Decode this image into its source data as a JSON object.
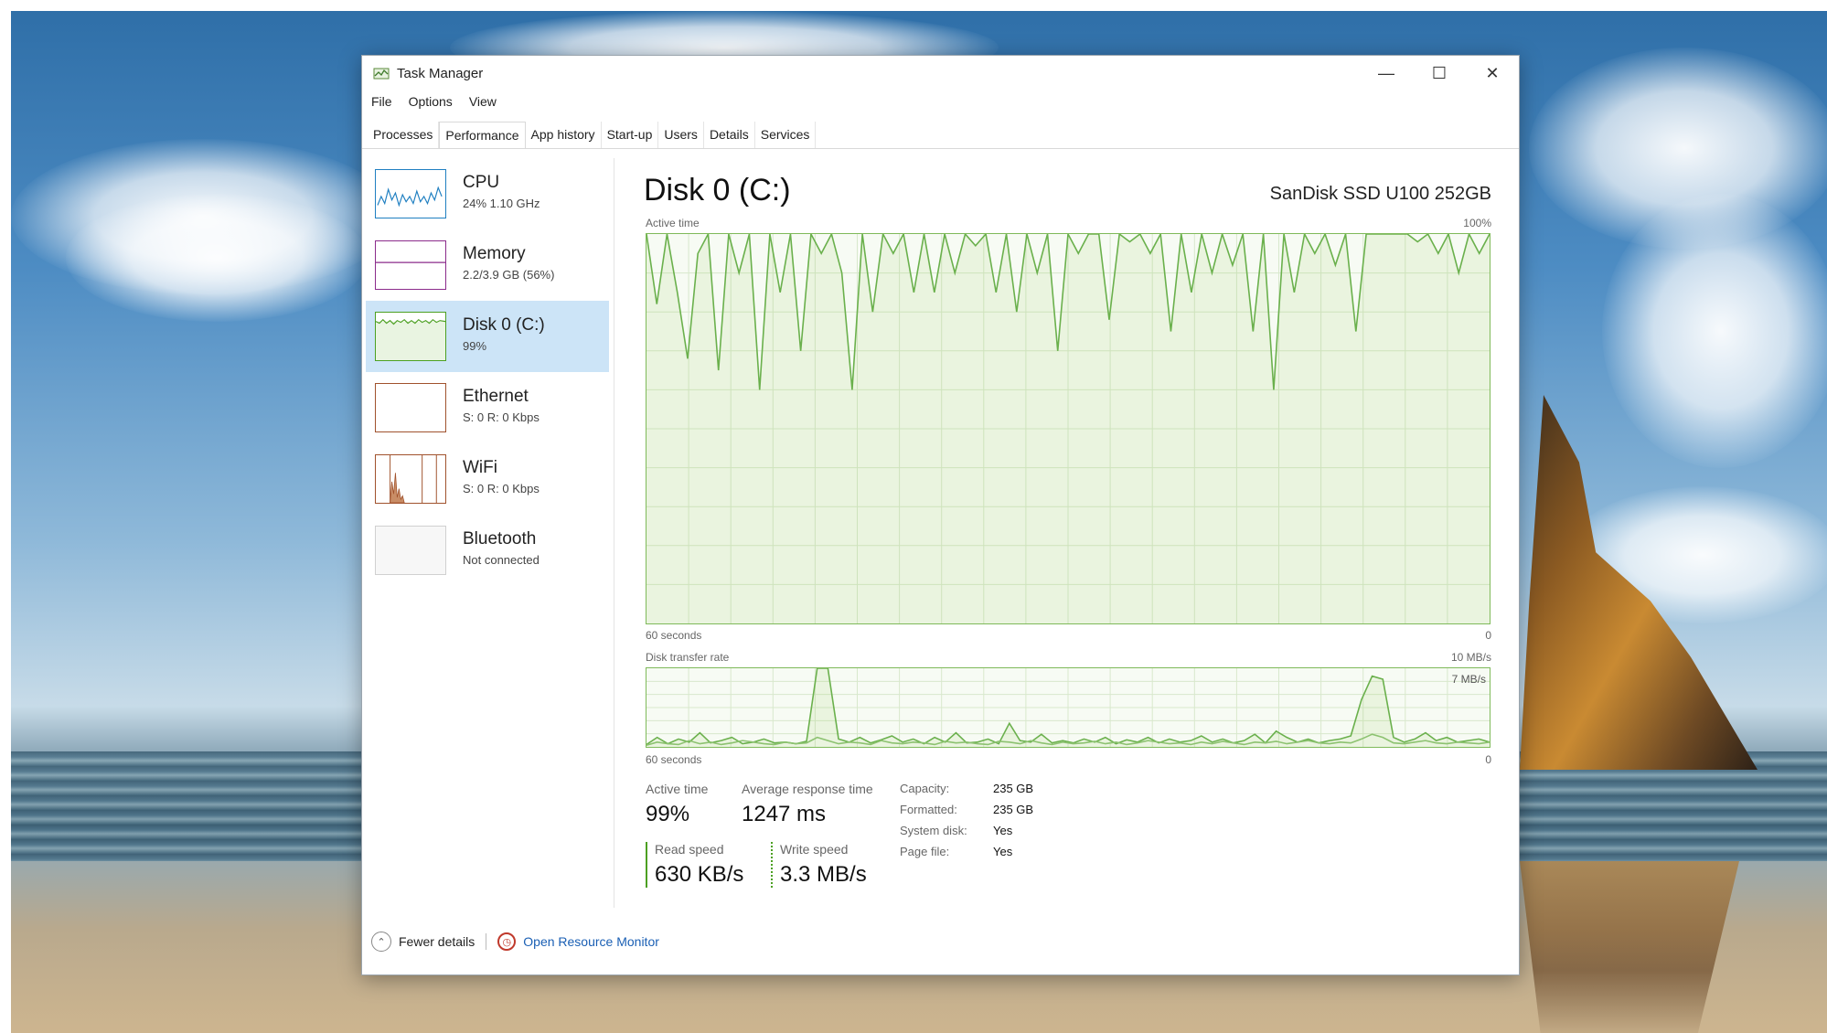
{
  "window": {
    "title": "Task Manager",
    "controls": {
      "minimize": "—",
      "maximize": "☐",
      "close": "✕"
    }
  },
  "menu": [
    "File",
    "Options",
    "View"
  ],
  "tabs": [
    {
      "label": "Processes",
      "active": false
    },
    {
      "label": "Performance",
      "active": true
    },
    {
      "label": "App history",
      "active": false
    },
    {
      "label": "Start-up",
      "active": false
    },
    {
      "label": "Users",
      "active": false
    },
    {
      "label": "Details",
      "active": false
    },
    {
      "label": "Services",
      "active": false
    }
  ],
  "sidebar": [
    {
      "name": "CPU",
      "sub": "24% 1.10 GHz",
      "color": "#1f7fc1",
      "selected": false
    },
    {
      "name": "Memory",
      "sub": "2.2/3.9 GB (56%)",
      "color": "#8b2b8b",
      "selected": false
    },
    {
      "name": "Disk 0 (C:)",
      "sub": "99%",
      "color": "#4ca022",
      "selected": true
    },
    {
      "name": "Ethernet",
      "sub": "S: 0 R: 0 Kbps",
      "color": "#a0522d",
      "selected": false
    },
    {
      "name": "WiFi",
      "sub": "S: 0 R: 0 Kbps",
      "color": "#a0522d",
      "selected": false
    },
    {
      "name": "Bluetooth",
      "sub": "Not connected",
      "color": "#c9c9c9",
      "selected": false
    }
  ],
  "disk": {
    "title": "Disk 0 (C:)",
    "model": "SanDisk SSD U100 252GB"
  },
  "charts": {
    "active_time": {
      "label": "Active time",
      "max_label": "100%",
      "time_label": "60 seconds",
      "min_label": "0"
    },
    "transfer": {
      "label": "Disk transfer rate",
      "max_label": "10 MB/s",
      "secondary_label": "7 MB/s",
      "time_label": "60 seconds",
      "min_label": "0"
    }
  },
  "chart_data": [
    {
      "type": "line",
      "title": "Active time",
      "ylim": [
        0,
        100
      ],
      "x_label": "60 seconds",
      "series": [
        {
          "values": [
            100,
            82,
            100,
            85,
            68,
            95,
            100,
            65,
            100,
            90,
            100,
            60,
            100,
            85,
            100,
            70,
            100,
            95,
            100,
            90,
            60,
            100,
            80,
            100,
            95,
            100,
            85,
            100,
            85,
            100,
            90,
            100,
            97,
            100,
            85,
            100,
            80,
            100,
            90,
            100,
            70,
            100,
            95,
            100,
            100,
            78,
            100,
            98,
            100,
            95,
            100,
            75,
            100,
            85,
            100,
            90,
            100,
            92,
            100,
            75,
            100,
            60,
            100,
            85,
            100,
            95,
            100,
            92,
            100,
            75,
            100,
            100,
            100,
            100,
            100,
            98,
            100,
            95,
            100,
            90,
            100,
            95,
            100
          ]
        }
      ]
    },
    {
      "type": "line",
      "title": "Disk transfer rate",
      "ylim": [
        0,
        10
      ],
      "x_label": "60 seconds",
      "series": [
        {
          "values": [
            0.3,
            1.2,
            0.4,
            1.0,
            0.6,
            1.8,
            0.5,
            0.8,
            1.2,
            0.4,
            0.6,
            1.0,
            0.5,
            0.6,
            0.4,
            0.7,
            10,
            10,
            1.0,
            0.6,
            1.2,
            0.5,
            0.9,
            1.4,
            0.6,
            1.0,
            0.4,
            1.2,
            0.6,
            1.8,
            0.5,
            0.6,
            1.0,
            0.4,
            3.0,
            0.8,
            0.6,
            1.6,
            0.5,
            0.8,
            0.5,
            1.0,
            0.6,
            1.2,
            0.4,
            0.9,
            0.6,
            1.2,
            0.5,
            1.0,
            0.6,
            0.8,
            1.4,
            0.6,
            1.0,
            0.5,
            0.8,
            1.6,
            0.5,
            2.0,
            1.2,
            0.6,
            1.0,
            0.5,
            0.8,
            1.0,
            1.4,
            6.0,
            9.0,
            8.6,
            1.2,
            0.6,
            1.0,
            1.8,
            0.8,
            1.2,
            0.6,
            0.8,
            1.0,
            0.6
          ]
        },
        {
          "values": [
            0.2,
            0.6,
            0.4,
            0.3,
            0.8,
            0.4,
            0.6,
            0.3,
            0.5,
            0.8,
            0.6,
            0.4,
            0.3,
            0.6,
            0.4,
            0.5,
            1.2,
            0.8,
            0.4,
            0.6,
            0.5,
            0.3,
            0.8,
            0.5,
            0.4,
            0.6,
            0.5,
            0.3,
            0.7,
            0.5,
            0.6,
            0.4,
            0.3,
            0.7,
            0.6,
            0.4,
            0.8,
            0.5,
            0.3,
            0.6,
            0.4,
            0.5,
            0.7,
            0.4,
            0.6,
            0.3,
            0.5,
            0.8,
            0.6,
            0.4,
            0.5,
            0.3,
            0.6,
            0.4,
            0.7,
            0.5,
            0.3,
            0.6,
            0.5,
            0.7,
            0.4,
            0.6,
            0.8,
            0.5,
            0.4,
            0.6,
            0.5,
            1.0,
            1.6,
            1.2,
            0.5,
            0.4,
            0.6,
            0.8,
            0.5,
            0.4,
            0.6,
            0.5,
            0.4,
            0.6
          ]
        }
      ]
    }
  ],
  "stats": {
    "active_time_label": "Active time",
    "active_time_value": "99%",
    "response_label": "Average response time",
    "response_value": "1247 ms",
    "read_label": "Read speed",
    "read_value": "630 KB/s",
    "write_label": "Write speed",
    "write_value": "3.3 MB/s"
  },
  "properties": [
    {
      "label": "Capacity:",
      "value": "235 GB"
    },
    {
      "label": "Formatted:",
      "value": "235 GB"
    },
    {
      "label": "System disk:",
      "value": "Yes"
    },
    {
      "label": "Page file:",
      "value": "Yes"
    }
  ],
  "footer": {
    "fewer_details": "Fewer details",
    "resource_monitor": "Open Resource Monitor"
  }
}
